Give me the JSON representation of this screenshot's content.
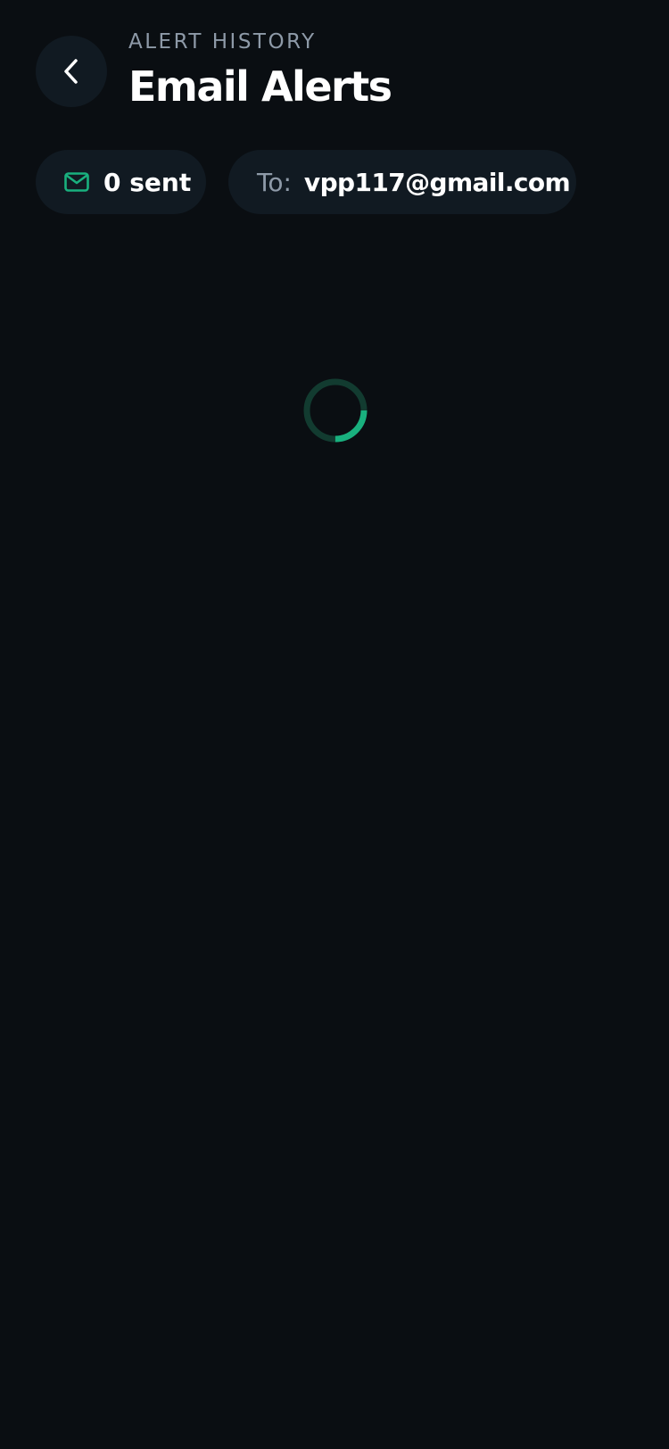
{
  "header": {
    "eyebrow": "ALERT HISTORY",
    "title": "Email Alerts",
    "back_icon": "chevron-left-icon"
  },
  "stats": {
    "sent_icon": "mail-icon",
    "sent_label": "0 sent",
    "to_label": "To:",
    "to_email": "vpp117@gmail.com"
  },
  "loading": {
    "spinner_icon": "loading-spinner-icon",
    "progress": 0.25
  },
  "colors": {
    "background": "#0a0e12",
    "surface": "#111a22",
    "accent": "#19b07e",
    "accent_track": "#123b30",
    "muted_text": "#8e9aa8",
    "text": "#ffffff"
  }
}
